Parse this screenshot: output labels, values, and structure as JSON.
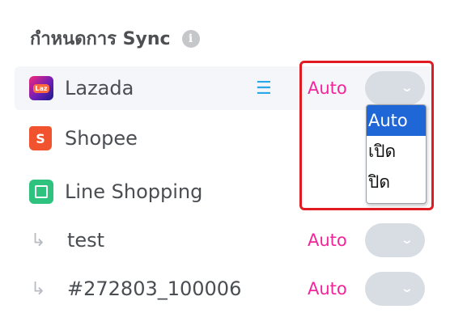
{
  "section_title": "กำหนดการ Sync",
  "info_icon": "i",
  "channels": [
    {
      "name": "Lazada",
      "logo_text": "Laz",
      "mode": "Auto"
    },
    {
      "name": "Shopee",
      "logo_text": "S"
    },
    {
      "name": "Line Shopping"
    }
  ],
  "sub_shops": [
    {
      "name": "test",
      "mode": "Auto"
    },
    {
      "name": "#272803_100006",
      "mode": "Auto"
    }
  ],
  "dropdown": {
    "options": [
      "Auto",
      "เปิด",
      "ปิด"
    ],
    "selected": "Auto"
  },
  "colors": {
    "mode_text": "#f2269a",
    "list_icon": "#2aa7e8",
    "highlight_box": "#e11b22",
    "selected_option": "#1f66d6"
  }
}
